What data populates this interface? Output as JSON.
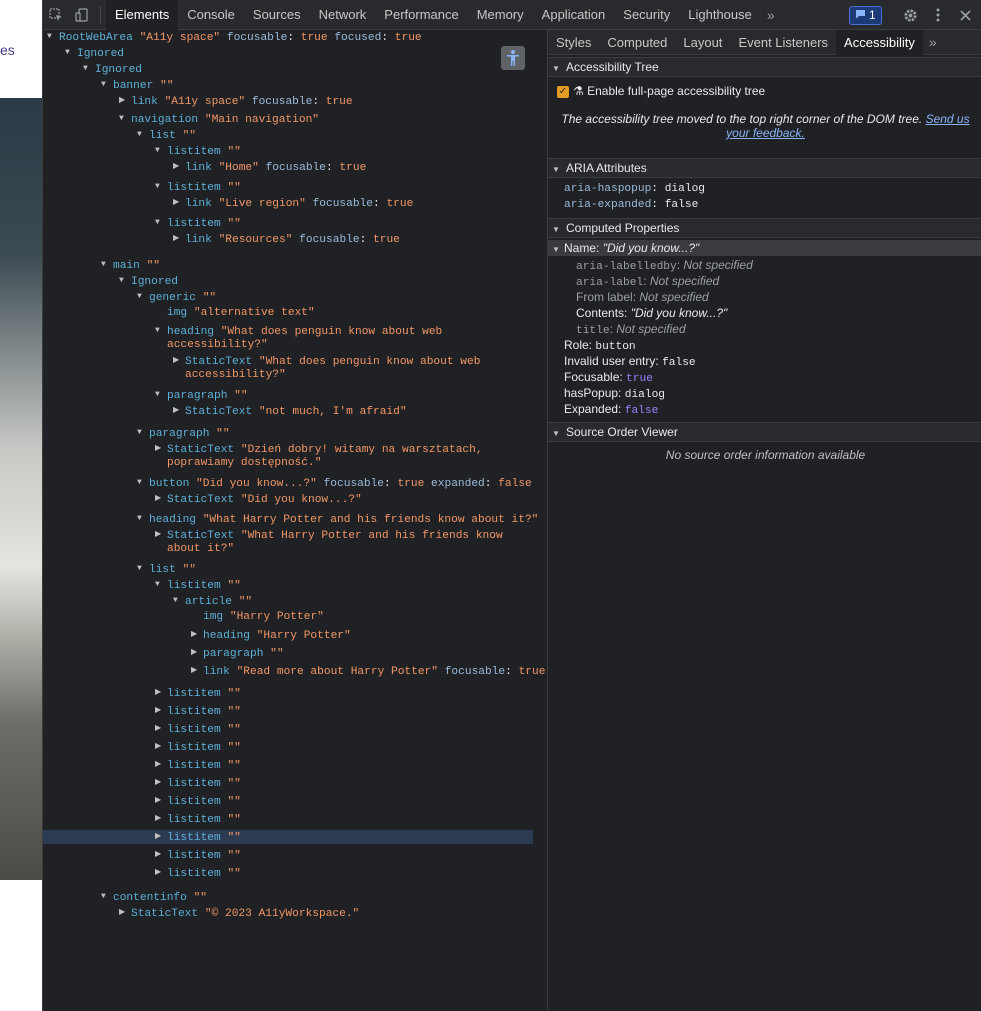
{
  "page": {
    "partial_text": "es"
  },
  "toolbar": {
    "tabs": [
      "Elements",
      "Console",
      "Sources",
      "Network",
      "Performance",
      "Memory",
      "Application",
      "Security",
      "Lighthouse"
    ],
    "active_tab": "Elements",
    "issues_count": "1"
  },
  "sidebar": {
    "tabs": [
      "Styles",
      "Computed",
      "Layout",
      "Event Listeners",
      "Accessibility"
    ],
    "active_tab": "Accessibility",
    "a11y_tree": {
      "title": "Accessibility Tree",
      "checkbox_label": "Enable full-page accessibility tree",
      "note": "The accessibility tree moved to the top right corner of the DOM tree.",
      "feedback_link": "Send us your feedback."
    },
    "aria": {
      "title": "ARIA Attributes",
      "attrs": [
        {
          "name": "aria-haspopup",
          "value": "dialog"
        },
        {
          "name": "aria-expanded",
          "value": "false"
        }
      ]
    },
    "computed": {
      "title": "Computed Properties",
      "name_label": "Name:",
      "name_value": "\"Did you know...?\"",
      "sources": [
        {
          "label": "aria-labelledby",
          "value": "Not specified"
        },
        {
          "label": "aria-label",
          "value": "Not specified"
        },
        {
          "label": "From label",
          "value": "Not specified"
        },
        {
          "label": "Contents",
          "value": "\"Did you know...?\""
        },
        {
          "label": "title",
          "value": "Not specified"
        }
      ],
      "props": [
        {
          "label": "Role:",
          "value": "button"
        },
        {
          "label": "Invalid user entry:",
          "value": "false"
        },
        {
          "label": "Focusable:",
          "value": "true"
        },
        {
          "label": "hasPopup:",
          "value": "dialog"
        },
        {
          "label": "Expanded:",
          "value": "false"
        }
      ]
    },
    "source_order": {
      "title": "Source Order Viewer",
      "empty": "No source order information available"
    }
  },
  "tree": [
    {
      "role": "RootWebArea",
      "name": "\"A11y space\"",
      "props": [
        [
          "focusable",
          "true"
        ],
        [
          "focused",
          "true"
        ]
      ],
      "tri": "down"
    },
    {
      "role": "Ignored",
      "tri": "down"
    },
    {
      "role": "Ignored",
      "tri": "down"
    },
    {
      "role": "banner",
      "name": "\"\"",
      "tri": "down"
    },
    {
      "role": "link",
      "name": "\"A11y space\"",
      "props": [
        [
          "focusable",
          "true"
        ]
      ],
      "tri": "right"
    },
    {
      "role": "navigation",
      "name": "\"Main navigation\"",
      "tri": "down"
    },
    {
      "role": "list",
      "name": "\"\"",
      "tri": "down"
    },
    {
      "role": "listitem",
      "name": "\"\"",
      "tri": "down"
    },
    {
      "role": "link",
      "name": "\"Home\"",
      "props": [
        [
          "focusable",
          "true"
        ]
      ],
      "tri": "right"
    },
    {
      "role": "listitem",
      "name": "\"\"",
      "tri": "down"
    },
    {
      "role": "link",
      "name": "\"Live region\"",
      "props": [
        [
          "focusable",
          "true"
        ]
      ],
      "tri": "right"
    },
    {
      "role": "listitem",
      "name": "\"\"",
      "tri": "down"
    },
    {
      "role": "link",
      "name": "\"Resources\"",
      "props": [
        [
          "focusable",
          "true"
        ]
      ],
      "tri": "right"
    },
    {
      "role": "main",
      "name": "\"\"",
      "tri": "down"
    },
    {
      "role": "Ignored",
      "tri": "down"
    },
    {
      "role": "generic",
      "name": "\"\"",
      "tri": "down"
    },
    {
      "role": "img",
      "name": "\"alternative text\""
    },
    {
      "role": "heading",
      "name": "\"What does penguin know about web",
      "name2": "accessibility?\"",
      "tri": "down"
    },
    {
      "role": "StaticText",
      "name": "\"What does penguin know about web",
      "name2": "accessibility?\"",
      "tri": "right"
    },
    {
      "role": "paragraph",
      "name": "\"\"",
      "tri": "down"
    },
    {
      "role": "StaticText",
      "name": "\"not much, I'm afraid\"",
      "tri": "right"
    },
    {
      "role": "paragraph",
      "name": "\"\"",
      "tri": "down"
    },
    {
      "role": "StaticText",
      "name": "\"Dzień dobry! witamy na warsztatach,",
      "name2": "poprawiamy dostępność.\"",
      "tri": "right"
    },
    {
      "role": "button",
      "name": "\"Did you know...?\"",
      "props": [
        [
          "focusable",
          "true"
        ],
        [
          "expanded",
          "false"
        ]
      ],
      "tri": "down"
    },
    {
      "role": "StaticText",
      "name": "\"Did you know...?\"",
      "tri": "right"
    },
    {
      "role": "heading",
      "name": "\"What Harry Potter and his friends know about it?\"",
      "tri": "down"
    },
    {
      "role": "StaticText",
      "name": "\"What Harry Potter and his friends know",
      "name2": "about it?\"",
      "tri": "right"
    },
    {
      "role": "list",
      "name": "\"\"",
      "tri": "down"
    },
    {
      "role": "listitem",
      "name": "\"\"",
      "tri": "down"
    },
    {
      "role": "article",
      "name": "\"\"",
      "tri": "down"
    },
    {
      "role": "img",
      "name": "\"Harry Potter\""
    },
    {
      "role": "heading",
      "name": "\"Harry Potter\"",
      "tri": "right"
    },
    {
      "role": "paragraph",
      "name": "\"\"",
      "tri": "right"
    },
    {
      "role": "link",
      "name": "\"Read more about Harry Potter\"",
      "props": [
        [
          "focusable",
          "true"
        ]
      ],
      "tri": "right"
    },
    {
      "role": "listitem",
      "name": "\"\"",
      "tri": "right"
    },
    {
      "role": "listitem",
      "name": "\"\"",
      "tri": "right"
    },
    {
      "role": "listitem",
      "name": "\"\"",
      "tri": "right"
    },
    {
      "role": "listitem",
      "name": "\"\"",
      "tri": "right"
    },
    {
      "role": "listitem",
      "name": "\"\"",
      "tri": "right"
    },
    {
      "role": "listitem",
      "name": "\"\"",
      "tri": "right"
    },
    {
      "role": "listitem",
      "name": "\"\"",
      "tri": "right"
    },
    {
      "role": "listitem",
      "name": "\"\"",
      "tri": "right"
    },
    {
      "role": "listitem",
      "name": "\"\"",
      "tri": "right"
    },
    {
      "role": "listitem",
      "name": "\"\"",
      "tri": "right"
    },
    {
      "role": "listitem",
      "name": "\"\"",
      "tri": "right"
    },
    {
      "role": "contentinfo",
      "name": "\"\"",
      "tri": "down"
    },
    {
      "role": "StaticText",
      "name": "\"© 2023 A11yWorkspace.\"",
      "tri": "right"
    }
  ],
  "colors": {
    "accent": "#e39c23",
    "role": "#5db0d7",
    "string": "#f29766",
    "keyword": "#9980ff"
  }
}
